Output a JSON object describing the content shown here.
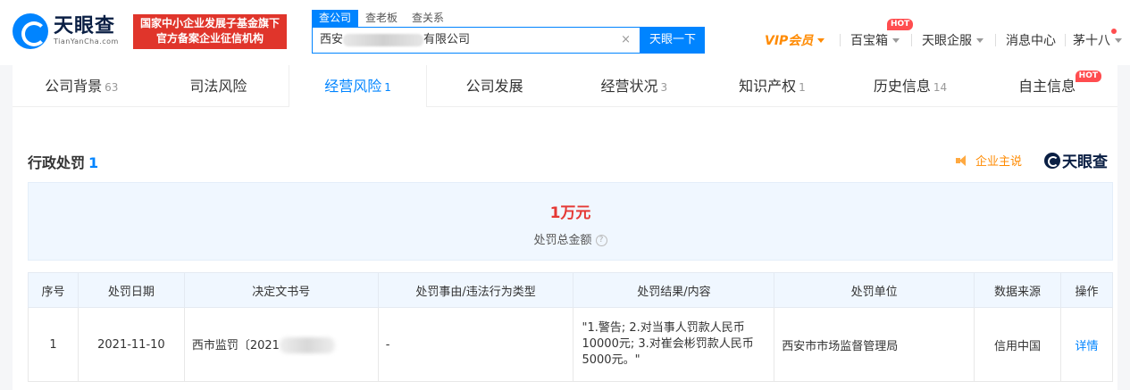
{
  "header": {
    "logo_cn": "天眼查",
    "logo_en": "TianYanCha.com",
    "badge_line1": "国家中小企业发展子基金旗下",
    "badge_line2": "官方备案企业征信机构",
    "search_tabs": [
      "查公司",
      "查老板",
      "查关系"
    ],
    "search_value_prefix": "西安",
    "search_value_suffix": "有限公司",
    "search_clear": "×",
    "search_button": "天眼一下",
    "nav": {
      "vip": "VIP会员",
      "baibaoxiang": "百宝箱",
      "hot": "HOT",
      "enterprise": "天眼企服",
      "messages": "消息中心",
      "user": "茅十八"
    }
  },
  "tabs": [
    {
      "label": "公司背景",
      "count": "63"
    },
    {
      "label": "司法风险",
      "count": ""
    },
    {
      "label": "经营风险",
      "count": "1"
    },
    {
      "label": "公司发展",
      "count": ""
    },
    {
      "label": "经营状况",
      "count": "3"
    },
    {
      "label": "知识产权",
      "count": "1"
    },
    {
      "label": "历史信息",
      "count": "14"
    },
    {
      "label": "自主信息",
      "count": ""
    }
  ],
  "tab_hot": "HOT",
  "section": {
    "title": "行政处罚",
    "count": "1",
    "enterprise_say": "企业主说",
    "brand": "天眼查"
  },
  "summary": {
    "amount": "1万元",
    "label": "处罚总金额",
    "help": "?"
  },
  "table": {
    "headers": [
      "序号",
      "处罚日期",
      "决定文书号",
      "处罚事由/违法行为类型",
      "处罚结果/内容",
      "处罚单位",
      "数据来源",
      "操作"
    ],
    "rows": [
      {
        "index": "1",
        "date": "2021-11-10",
        "doc_prefix": "西市监罚〔2021",
        "reason": "-",
        "result": "\"1.警告; 2.对当事人罚款人民币10000元; 3.对崔会彬罚款人民币5000元。\"",
        "unit": "西安市市场监督管理局",
        "source": "信用中国",
        "action": "详情"
      }
    ]
  },
  "colors": {
    "accent": "#0084ff",
    "red": "#e53935",
    "orange": "#ff8a00"
  }
}
